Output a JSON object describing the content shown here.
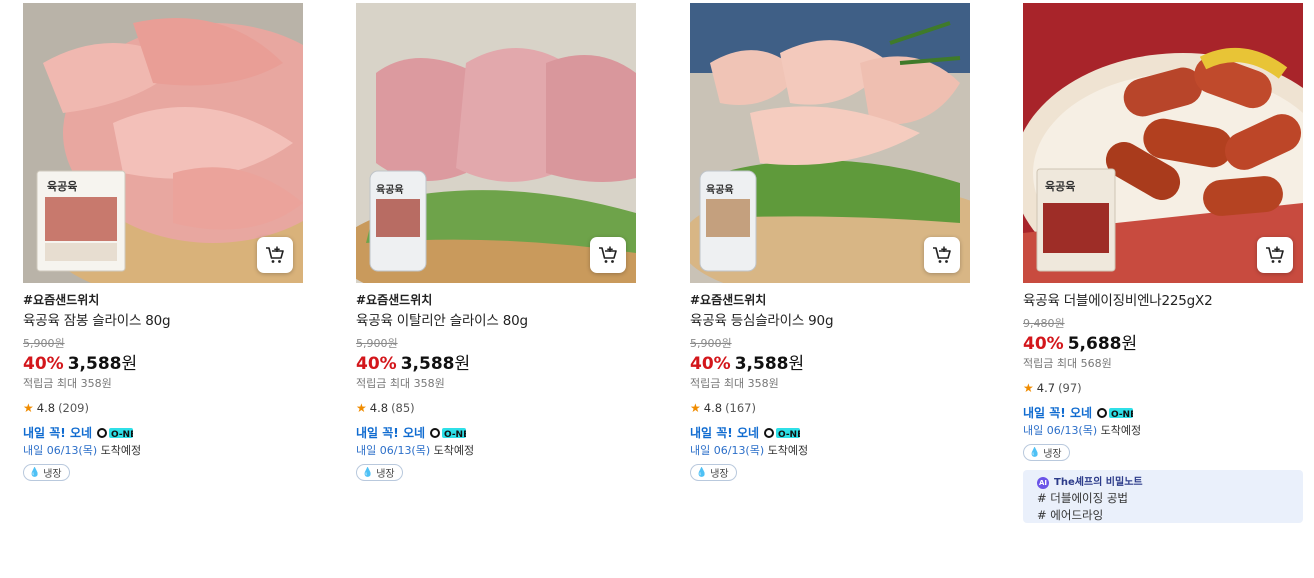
{
  "products": [
    {
      "tag": "#요즘샌드위치",
      "name": "육공육 잠봉 슬라이스 80g",
      "original_price": "5,900원",
      "discount": "40%",
      "price": "3,588",
      "currency": "원",
      "points": "적립금 최대 358원",
      "rating": "4.8",
      "reviews": "(209)",
      "delivery_label": "내일 꼭! 오네",
      "delivery_date": "내일 06/13(목)",
      "delivery_suffix": "도착예정",
      "storage": "냉장",
      "package_label": "육공육"
    },
    {
      "tag": "#요즘샌드위치",
      "name": "육공육 이탈리안 슬라이스 80g",
      "original_price": "5,900원",
      "discount": "40%",
      "price": "3,588",
      "currency": "원",
      "points": "적립금 최대 358원",
      "rating": "4.8",
      "reviews": "(85)",
      "delivery_label": "내일 꼭! 오네",
      "delivery_date": "내일 06/13(목)",
      "delivery_suffix": "도착예정",
      "storage": "냉장",
      "package_label": "육공육"
    },
    {
      "tag": "#요즘샌드위치",
      "name": "육공육 등심슬라이스 90g",
      "original_price": "5,900원",
      "discount": "40%",
      "price": "3,588",
      "currency": "원",
      "points": "적립금 최대 358원",
      "rating": "4.8",
      "reviews": "(167)",
      "delivery_label": "내일 꼭! 오네",
      "delivery_date": "내일 06/13(목)",
      "delivery_suffix": "도착예정",
      "storage": "냉장",
      "package_label": "육공육"
    },
    {
      "name": "육공육 더블에이징비엔나225gX2",
      "original_price": "9,480원",
      "discount": "40%",
      "price": "5,688",
      "currency": "원",
      "points": "적립금 최대 568원",
      "rating": "4.7",
      "reviews": "(97)",
      "delivery_label": "내일 꼭! 오네",
      "delivery_date": "내일 06/13(목)",
      "delivery_suffix": "도착예정",
      "storage": "냉장",
      "package_label": "육공육",
      "chef_note": {
        "title": "The셰프의 비밀노트",
        "lines": [
          "# 더블에이징 공법",
          "# 에어드라잉"
        ]
      }
    }
  ],
  "one_logo": "O-NE",
  "colors": {
    "discount": "#d3161b",
    "delivery": "#0f6bd0",
    "star": "#f08c00",
    "chef_bg": "#eaf0fb"
  },
  "icons": [
    "cart-add-icon",
    "star-icon",
    "drop-icon",
    "ai-icon",
    "one-logo-icon"
  ]
}
